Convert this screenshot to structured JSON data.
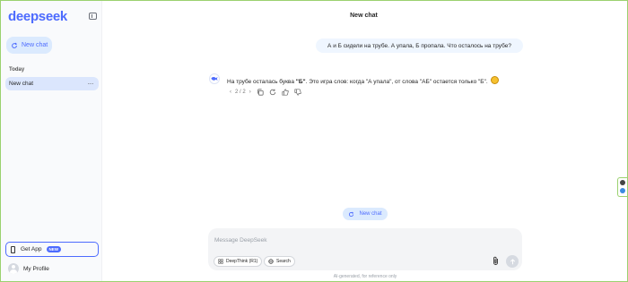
{
  "sidebar": {
    "logo": "deepseek",
    "new_chat_label": "New chat",
    "section_today": "Today",
    "chat_items": [
      {
        "label": "New chat",
        "menu": "···"
      }
    ],
    "get_app_label": "Get App",
    "get_app_badge": "NEW",
    "profile_label": "My Profile"
  },
  "main": {
    "title": "New chat",
    "user_message": "А и Б сидели на трубе. А упала, Б пропала. Что осталось на трубе?",
    "assistant": {
      "text_before": "На трубе осталась буква ",
      "bold": "\"Б\"",
      "text_after": ". Это игра слов: когда \"А упала\", от слова \"АБ\" остается только \"Б\".",
      "pager": "2 / 2",
      "emoji_icon": "smile-emoji-icon"
    },
    "new_chat_float_label": "New chat",
    "composer": {
      "placeholder": "Message DeepSeek",
      "value": "",
      "deepthink_label": "DeepThink (R1)",
      "search_label": "Search"
    },
    "disclaimer": "AI-generated, for reference only"
  },
  "colors": {
    "accent": "#4d6bfe",
    "accent_bg": "#dbeafe",
    "sidebar_bg": "#f9fafc",
    "composer_bg": "#f3f4f6"
  }
}
